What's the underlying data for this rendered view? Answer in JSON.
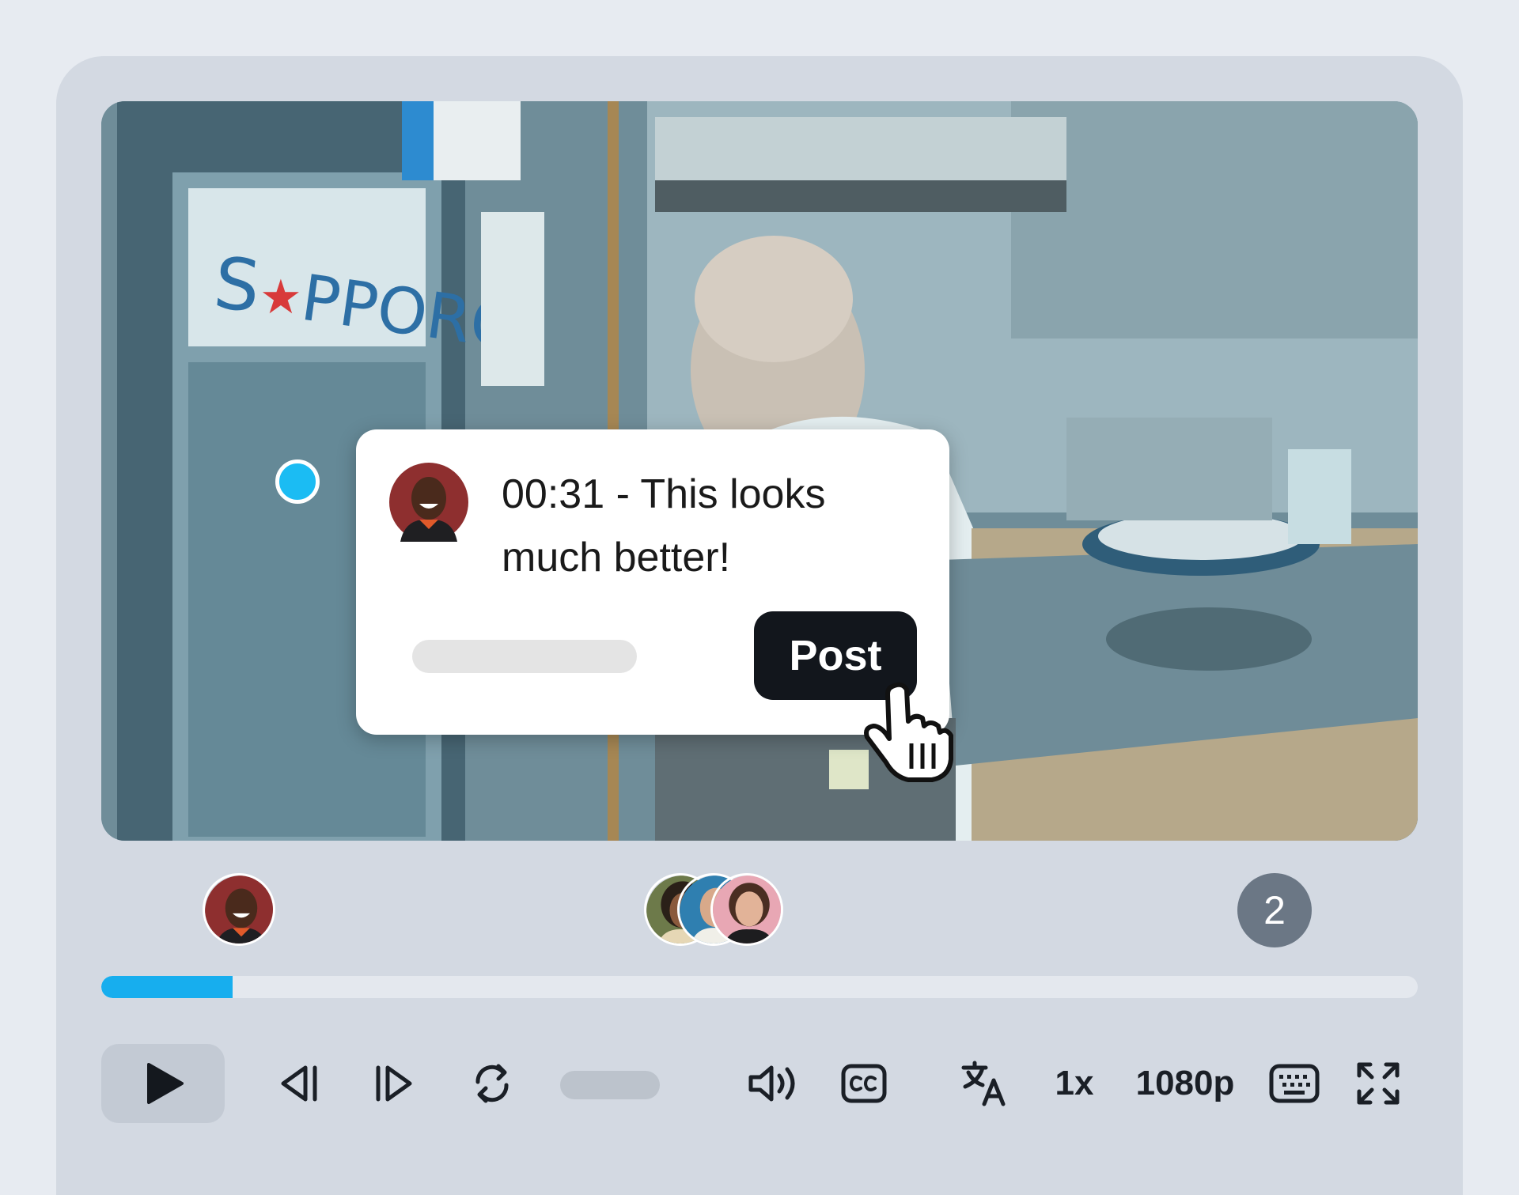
{
  "comment": {
    "text": "00:31 - This looks much better!",
    "reply_placeholder": "",
    "post_label": "Post"
  },
  "viewers": {
    "extra_count": "2"
  },
  "playback": {
    "progress_fraction": 0.1,
    "speed_label": "1x",
    "quality_label": "1080p"
  },
  "colors": {
    "accent": "#17aeee",
    "post_button": "#12161c",
    "badge": "#6b7785"
  },
  "icons": [
    "play-icon",
    "skip-back-icon",
    "skip-forward-icon",
    "loop-icon",
    "volume-icon",
    "closed-captions-icon",
    "translate-icon",
    "keyboard-icon",
    "fullscreen-icon",
    "hand-pointer-icon"
  ]
}
